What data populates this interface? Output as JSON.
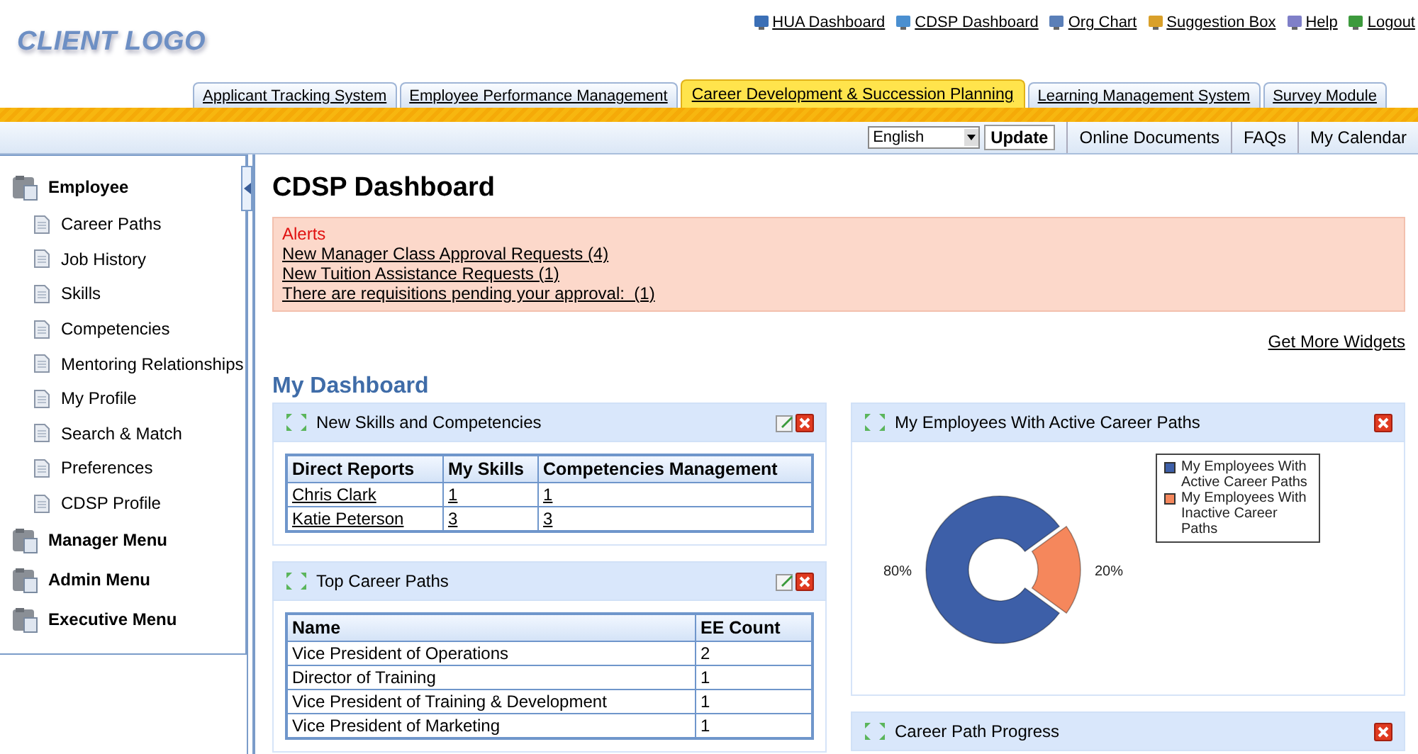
{
  "logo": "CLIENT LOGO",
  "top_links": [
    {
      "label": "HUA Dashboard"
    },
    {
      "label": "CDSP Dashboard"
    },
    {
      "label": "Org Chart"
    },
    {
      "label": "Suggestion Box"
    },
    {
      "label": "Help"
    },
    {
      "label": "Logout"
    }
  ],
  "tabs": [
    {
      "label": "Applicant Tracking System",
      "selected": false
    },
    {
      "label": "Employee Performance Management",
      "selected": false
    },
    {
      "label": "Career Development & Succession Planning",
      "selected": true
    },
    {
      "label": "Learning Management System",
      "selected": false
    },
    {
      "label": "Survey Module",
      "selected": false
    }
  ],
  "language": {
    "value": "English"
  },
  "update_button": "Update",
  "utility_links": [
    "Online Documents",
    "FAQs",
    "My Calendar"
  ],
  "sidebar": {
    "items": [
      {
        "label": "Employee",
        "children": [
          {
            "label": "Career Paths"
          },
          {
            "label": "Job History"
          },
          {
            "label": "Skills"
          },
          {
            "label": "Competencies"
          },
          {
            "label": "Mentoring Relationships"
          },
          {
            "label": "My Profile"
          },
          {
            "label": "Search & Match"
          },
          {
            "label": "Preferences"
          },
          {
            "label": "CDSP Profile"
          }
        ]
      },
      {
        "label": "Manager Menu"
      },
      {
        "label": "Admin Menu"
      },
      {
        "label": "Executive Menu"
      }
    ]
  },
  "page_title": "CDSP Dashboard",
  "alerts": {
    "title": "Alerts",
    "links": [
      "New Manager Class Approval Requests (4)",
      "New Tuition Assistance Requests (1)",
      "There are requisitions pending your approval:  (1)"
    ]
  },
  "get_more_widgets": "Get More Widgets",
  "section_title": "My Dashboard",
  "widgets_left": [
    {
      "title": "New Skills and Competencies",
      "editable": true,
      "table": {
        "cells_linked": true,
        "columns": [
          "Direct Reports",
          "My Skills",
          "Competencies Management"
        ],
        "rows": [
          [
            "Chris Clark",
            "1",
            "1"
          ],
          [
            "Katie Peterson",
            "3",
            "3"
          ]
        ]
      }
    },
    {
      "title": "Top Career Paths",
      "editable": true,
      "table": {
        "cells_linked": false,
        "columns": [
          "Name",
          "EE Count"
        ],
        "rows": [
          [
            "Vice President of Operations",
            "2"
          ],
          [
            "Director of Training",
            "1"
          ],
          [
            "Vice President of Training & Development",
            "1"
          ],
          [
            "Vice President of Marketing",
            "1"
          ]
        ]
      }
    }
  ],
  "widgets_right": [
    {
      "title": "My Employees With Active Career Paths",
      "editable": false,
      "chart_data": {
        "type": "donut",
        "categories": [
          "My Employees With Active Career Paths",
          "My Employees With Inactive Career Paths"
        ],
        "values": [
          80,
          20
        ],
        "colors": [
          "#3d5fa8",
          "#f5875c"
        ],
        "value_labels": [
          "80%",
          "20%"
        ],
        "legend": true
      }
    },
    {
      "title": "Career Path Progress",
      "editable": false
    }
  ]
}
